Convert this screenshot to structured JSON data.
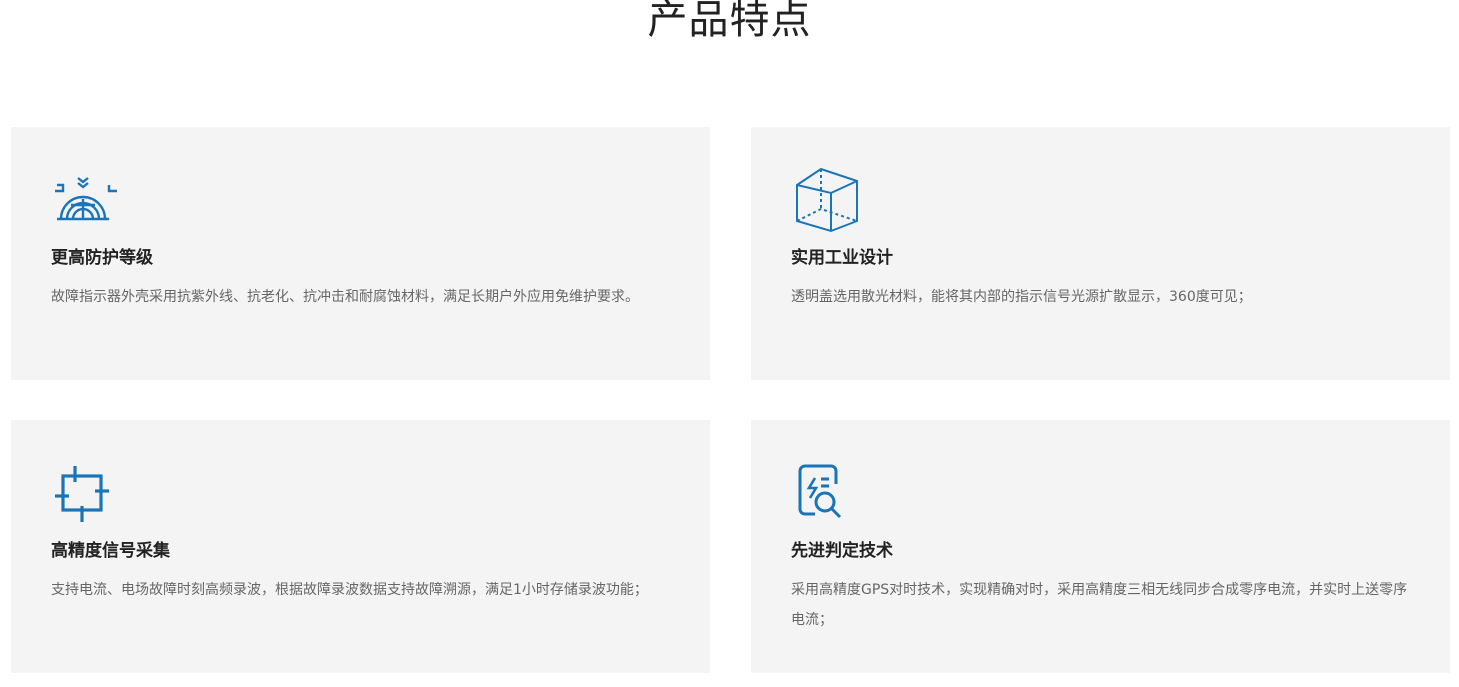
{
  "section": {
    "title": "产品特点"
  },
  "features": [
    {
      "icon": "shield-radar-icon",
      "title": "更高防护等级",
      "description": "故障指示器外壳采用抗紫外线、抗老化、抗冲击和耐腐蚀材料，满足长期户外应用免维护要求。"
    },
    {
      "icon": "cube-icon",
      "title": "实用工业设计",
      "description": "透明盖选用散光材料，能将其内部的指示信号光源扩散显示，360度可见；"
    },
    {
      "icon": "crosshair-chip-icon",
      "title": "高精度信号采集",
      "description": "支持电流、电场故障时刻高频录波，根据故障录波数据支持故障溯源，满足1小时存储录波功能；"
    },
    {
      "icon": "document-search-icon",
      "title": "先进判定技术",
      "description": "采用高精度GPS对时技术，实现精确对时，采用高精度三相无线同步合成零序电流，并实时上送零序电流；"
    }
  ],
  "colors": {
    "accent": "#1a75b8",
    "card_bg": "#f4f4f4",
    "title": "#222222",
    "text": "#666666"
  }
}
